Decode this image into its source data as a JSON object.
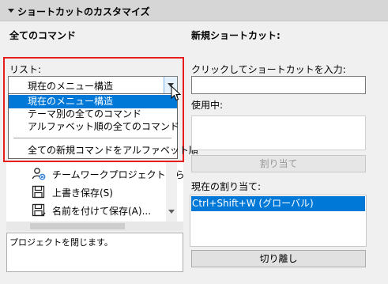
{
  "section": {
    "title": "ショートカットのカスタマイズ"
  },
  "left": {
    "heading": "全てのコマンド",
    "list_label": "リスト:",
    "list_select_value": "現在のメニュー構造",
    "dropdown_options": [
      "現在のメニュー構造",
      "テーマ別の全てのコマンド",
      "アルファベット順の全てのコマンド",
      "全ての新規コマンドをアルファベット順"
    ],
    "commands": [
      {
        "label": "チームワークプロジェクトから退出",
        "icon": "teamwork-leave-icon"
      },
      {
        "label": "上書き保存(S)",
        "icon": "save-icon"
      },
      {
        "label": "名前を付けて保存(A)...",
        "icon": "save-as-icon"
      }
    ],
    "description": "プロジェクトを閉じます。"
  },
  "right": {
    "heading": "新規ショートカット:",
    "input_label": "クリックしてショートカットを入力:",
    "in_use_label": "使用中:",
    "assign_button": "割り当て",
    "current_label": "現在の割り当て:",
    "current_assignments": [
      "Ctrl+Shift+W (グローバル)"
    ],
    "detach_button": "切り離し"
  },
  "colors": {
    "accent": "#0078d7",
    "highlight_border": "#e81e1e"
  }
}
